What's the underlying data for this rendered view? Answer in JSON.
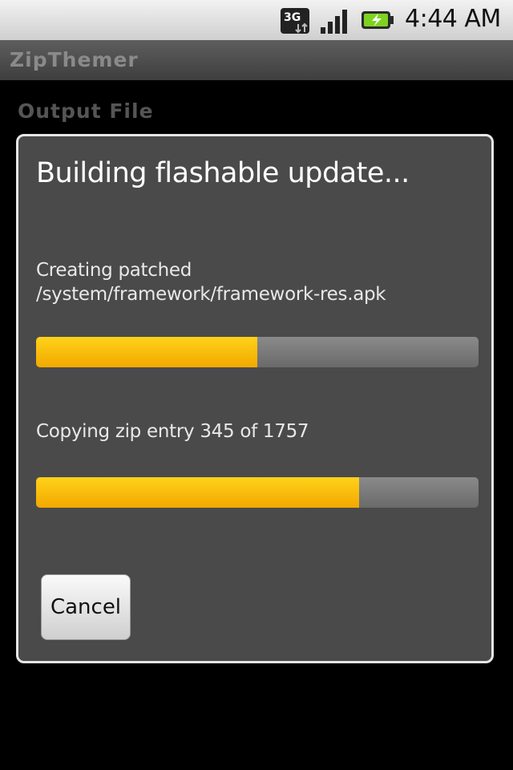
{
  "status_bar": {
    "network": "3G",
    "time": "4:44 AM",
    "icons": [
      "3g-data-icon",
      "signal-icon",
      "battery-charging-icon"
    ]
  },
  "app": {
    "title": "ZipThemer"
  },
  "background": {
    "section_label": "Output File"
  },
  "dialog": {
    "title": "Building flashable update...",
    "step_message": "Creating patched /system/framework/framework-res.apk",
    "step_progress": 0.5,
    "entry_message": "Copying zip entry 345 of 1757",
    "entry_progress": 0.73,
    "cancel_label": "Cancel"
  },
  "colors": {
    "progress_fill": "#ffcc00",
    "dialog_bg": "#4a4a4a"
  }
}
